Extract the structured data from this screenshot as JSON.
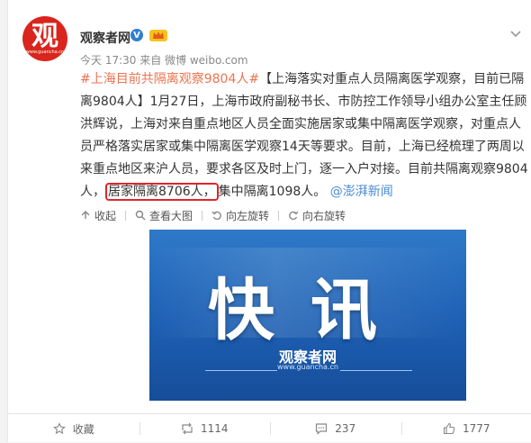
{
  "header": {
    "avatar_glyph": "观",
    "avatar_site": "www.guancha.cn",
    "username": "观察者网",
    "meta": "今天 17:30 来自 微博 weibo.com"
  },
  "post": {
    "hashtag": "#上海目前共隔离观察9804人#",
    "text_part1": "【上海落实对重点人员隔离医学观察，目前已隔离9804人】1月27日，上海市政府副秘书长、市防控工作领导小组办公室主任顾洪辉说，上海对来自重点地区人员全面实施居家或集中隔离医学观察，对重点人员严格落实居家或集中隔离医学观察14天等要求。目前，上海已经梳理了两周以来重点地区来沪人员，要求各区及时上门，逐一入户对接。目前共隔离观察9804人，",
    "highlighted": "居家隔离8706人，",
    "text_part2": "集中隔离1098人。",
    "mention": "@澎湃新闻"
  },
  "image_toolbar": {
    "collapse": "收起",
    "view_large": "查看大图",
    "rotate_left": "向左旋转",
    "rotate_right": "向右旋转"
  },
  "image": {
    "headline": "快讯",
    "brand": "观察者网",
    "site": "www.guancha.cn"
  },
  "actions": {
    "favorite": "收藏",
    "reposts": "1114",
    "comments": "237",
    "likes": "1777"
  },
  "colors": {
    "topic": "#eb7350",
    "mention": "#4a8bd6",
    "highlight_box": "#e0262b",
    "avatar_bg": "#d9251d"
  }
}
